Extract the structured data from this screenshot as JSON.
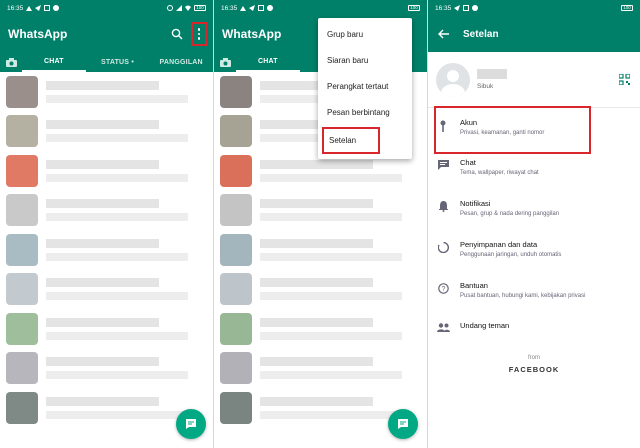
{
  "status_bar": {
    "time": "16:35",
    "battery": "100"
  },
  "main_screen": {
    "title": "WhatsApp",
    "tabs": {
      "chat": "CHAT",
      "status": "STATUS •",
      "calls": "PANGGILAN"
    },
    "icons": {
      "search": "search-icon",
      "more": "more-vertical-icon",
      "camera": "camera-icon",
      "new_chat": "new-chat-icon"
    }
  },
  "overflow_menu": {
    "items": [
      "Grup baru",
      "Siaran baru",
      "Perangkat tertaut",
      "Pesan berbintang",
      "Setelan"
    ]
  },
  "settings_screen": {
    "title": "Setelan",
    "profile_status": "Sibuk",
    "items": [
      {
        "title": "Akun",
        "subtitle": "Privasi, keamanan, ganti nomor",
        "icon": "key-icon"
      },
      {
        "title": "Chat",
        "subtitle": "Tema, wallpaper, riwayat chat",
        "icon": "chat-icon"
      },
      {
        "title": "Notifikasi",
        "subtitle": "Pesan, grup & nada dering panggilan",
        "icon": "bell-icon"
      },
      {
        "title": "Penyimpanan dan data",
        "subtitle": "Penggunaan jaringan, unduh otomatis",
        "icon": "data-usage-icon"
      },
      {
        "title": "Bantuan",
        "subtitle": "Pusat bantuan, hubungi kami, kebijakan privasi",
        "icon": "help-icon"
      },
      {
        "title": "Undang teman",
        "subtitle": "",
        "icon": "people-icon"
      }
    ],
    "footer_from": "from",
    "footer_brand": "FACEBOOK"
  },
  "colors": {
    "primary": "#008069",
    "fab": "#00a884",
    "highlight": "#d9262c"
  }
}
